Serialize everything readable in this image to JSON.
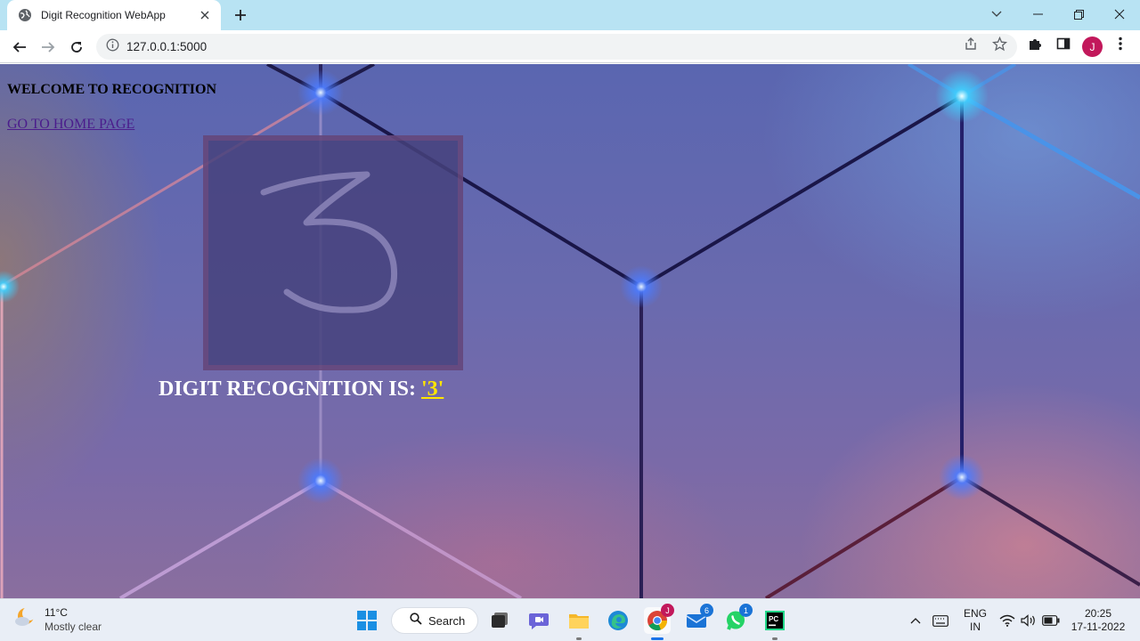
{
  "browser": {
    "tab_title": "Digit Recognition WebApp",
    "url": "127.0.0.1:5000",
    "profile_initial": "J"
  },
  "page": {
    "welcome": "WELCOME TO RECOGNITION",
    "home_link": "GO TO HOME PAGE",
    "drawn_digit": "3",
    "result_label": "DIGIT RECOGNITION IS:",
    "result_value": "'3'"
  },
  "taskbar": {
    "weather_temp": "11°C",
    "weather_condition": "Mostly clear",
    "search_label": "Search",
    "mail_badge": "6",
    "whatsapp_badge": "1",
    "chrome_badge": "J",
    "language_line1": "ENG",
    "language_line2": "IN",
    "time": "20:25",
    "date": "17-11-2022"
  },
  "colors": {
    "tabstrip": "#b8e3f3",
    "result_value": "#ffe600",
    "avatar": "#c2185b"
  }
}
